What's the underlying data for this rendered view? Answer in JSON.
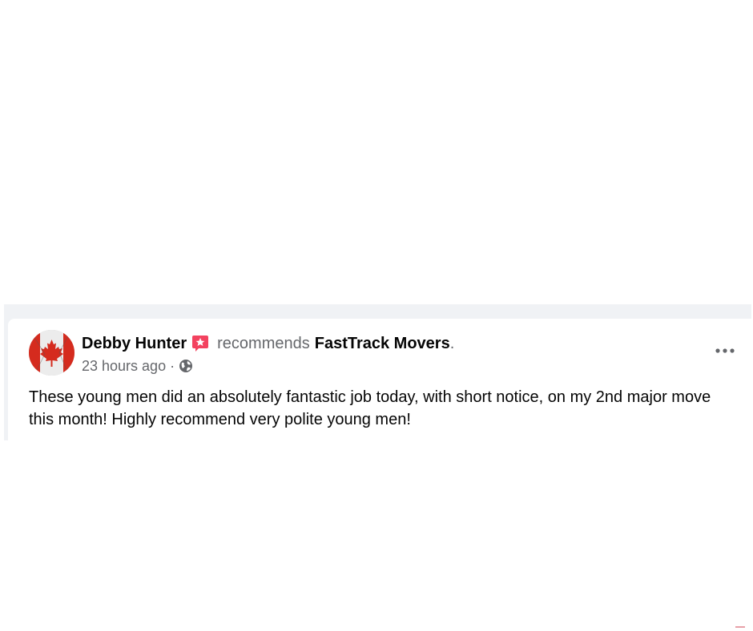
{
  "post": {
    "author_name": "Debby Hunter",
    "action_text": "recommends",
    "business_name": "FastTrack Movers",
    "period": ".",
    "timestamp": "23 hours ago",
    "separator": "·",
    "body": "These young men did an absolutely fantastic job today, with short notice,  on my 2nd major move this month!  Highly recommend very polite young men!"
  },
  "icons": {
    "avatar": "canada-flag-avatar",
    "badge": "recommendation-star-badge-icon",
    "audience": "globe-icon",
    "more": "more-options-icon"
  },
  "colors": {
    "text_primary": "#050505",
    "text_secondary": "#65676b",
    "badge": "#f3425f",
    "flag_red": "#d52b1e",
    "strip_bg": "#f0f2f5"
  }
}
